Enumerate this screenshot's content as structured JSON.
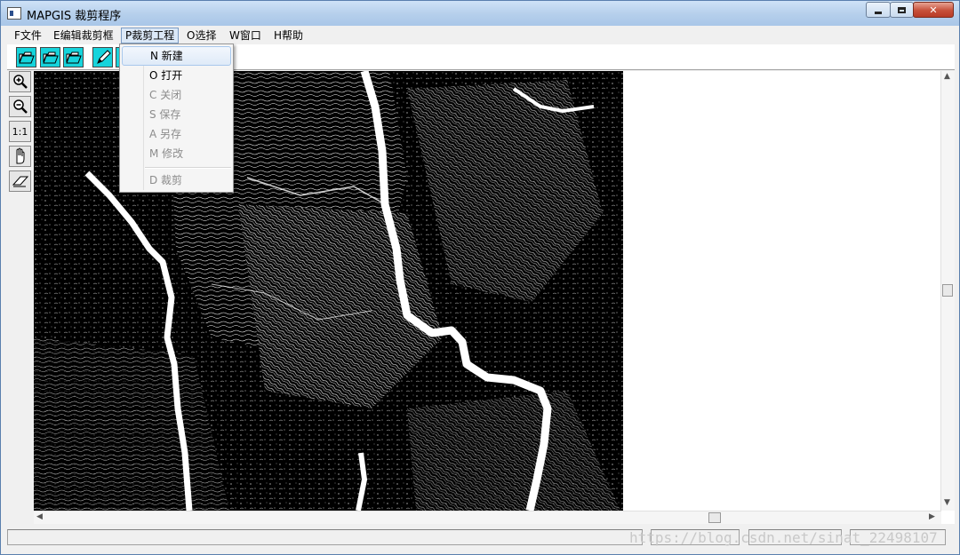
{
  "window": {
    "title": "MAPGIS 裁剪程序"
  },
  "menubar": {
    "items": [
      {
        "label": "F文件"
      },
      {
        "label": "E编辑裁剪框"
      },
      {
        "label": "P裁剪工程"
      },
      {
        "label": "O选择"
      },
      {
        "label": "W窗口"
      },
      {
        "label": "H帮助"
      }
    ]
  },
  "dropdown": {
    "items": [
      {
        "label": "N 新建",
        "enabled": true
      },
      {
        "label": "O 打开",
        "enabled": true
      },
      {
        "label": "C 关闭",
        "enabled": false
      },
      {
        "label": "S 保存",
        "enabled": false
      },
      {
        "label": "A 另存",
        "enabled": false
      },
      {
        "label": "M 修改",
        "enabled": false
      },
      {
        "label": "D 裁剪",
        "enabled": false
      }
    ]
  },
  "toolbar": {
    "icons": [
      "open-folder-icon",
      "open-folder-icon",
      "open-folder-icon",
      "pen-icon"
    ],
    "accent": "#16d4dc"
  },
  "left_toolbar": {
    "zoom_in_icon": "zoom-in-icon",
    "zoom_out_icon": "zoom-out-icon",
    "actual_size_label": "1:1",
    "pan_icon": "hand-icon",
    "eraser_icon": "eraser-icon"
  },
  "statusbar": {
    "watermark": "https://blog.csdn.net/sinat_22498107"
  }
}
